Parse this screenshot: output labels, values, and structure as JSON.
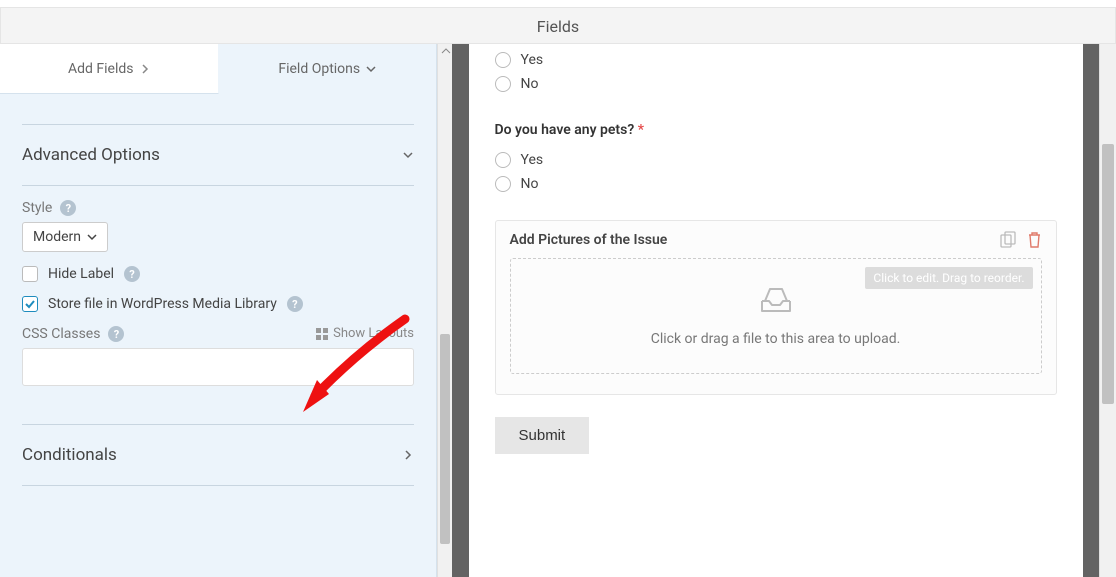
{
  "header": {
    "title": "Fields"
  },
  "tabs": {
    "add": "Add Fields",
    "options": "Field Options"
  },
  "sidebar": {
    "advanced": {
      "title": "Advanced Options"
    },
    "style": {
      "label": "Style",
      "selected": "Modern"
    },
    "hide_label": {
      "label": "Hide Label",
      "checked": false
    },
    "store_media": {
      "label": "Store file in WordPress Media Library",
      "checked": true
    },
    "css": {
      "label": "CSS Classes",
      "show_layouts": "Show Layouts",
      "value": ""
    },
    "conditionals": {
      "title": "Conditionals"
    }
  },
  "form": {
    "q1": {
      "opt_yes": "Yes",
      "opt_no": "No"
    },
    "q2": {
      "label": "Do you have any pets?",
      "opt_yes": "Yes",
      "opt_no": "No"
    },
    "upload": {
      "title": "Add Pictures of the Issue",
      "hint": "Click or drag a file to this area to upload.",
      "tooltip": "Click to edit. Drag to reorder."
    },
    "submit": "Submit"
  }
}
